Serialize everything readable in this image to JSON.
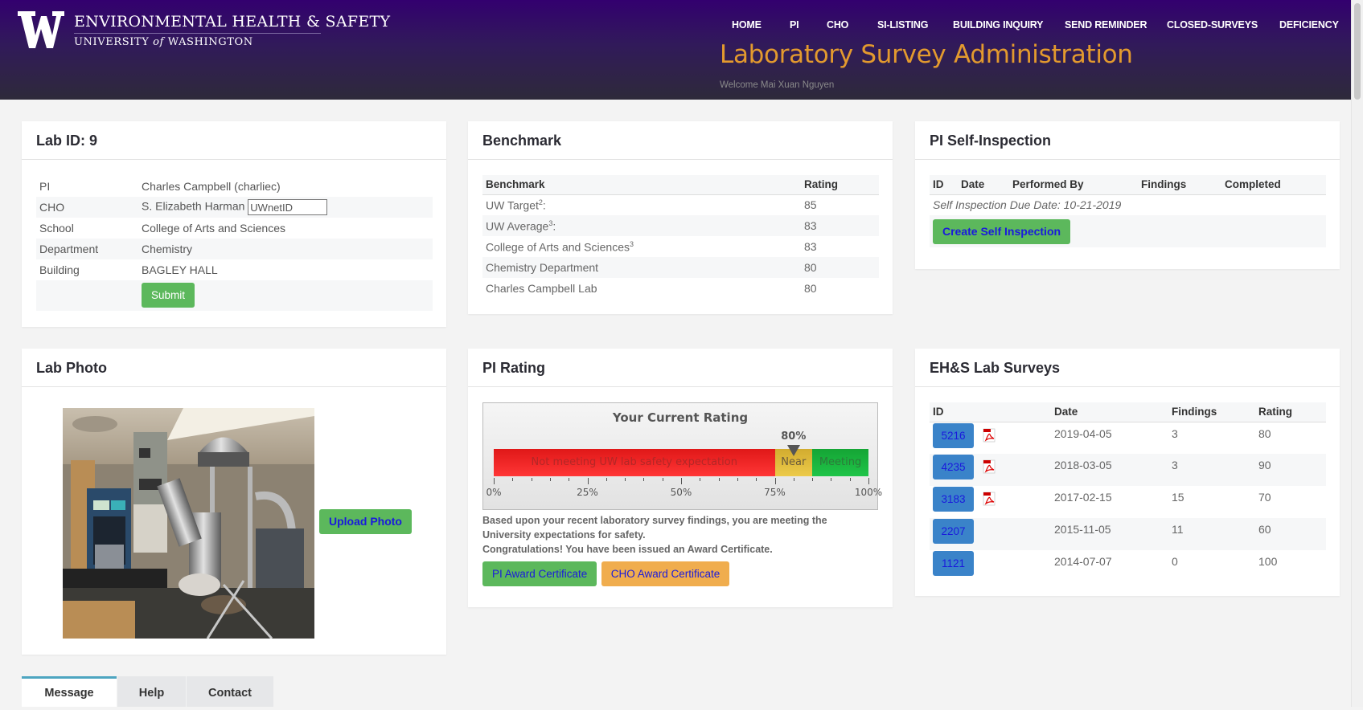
{
  "header": {
    "brand_line1": "ENVIRONMENTAL HEALTH & SAFETY",
    "brand_line2_pre": "UNIVERSITY",
    "brand_line2_of": "of",
    "brand_line2_post": "WASHINGTON",
    "app_title": "Laboratory Survey Administration",
    "welcome": "Welcome Mai Xuan Nguyen",
    "nav": [
      "HOME",
      "PI",
      "CHO",
      "SI-LISTING",
      "BUILDING INQUIRY",
      "SEND REMINDER",
      "CLOSED-SURVEYS",
      "DEFICIENCY"
    ]
  },
  "lab": {
    "title": "Lab ID: 9",
    "rows": [
      {
        "label": "PI",
        "value": "Charles Campbell (charliec)"
      },
      {
        "label": "CHO",
        "value": "S. Elizabeth Harman"
      },
      {
        "label": "School",
        "value": "College of Arts and Sciences"
      },
      {
        "label": "Department",
        "value": "Chemistry"
      },
      {
        "label": "Building",
        "value": "BAGLEY HALL"
      }
    ],
    "uwnetid_value": "UWnetID",
    "submit_label": "Submit"
  },
  "benchmark": {
    "title": "Benchmark",
    "headers": [
      "Benchmark",
      "Rating"
    ],
    "rows": [
      {
        "name": "UW Target",
        "sup": "2",
        "suffix": ":",
        "rating": "85"
      },
      {
        "name": "UW Average",
        "sup": "3",
        "suffix": ":",
        "rating": "83"
      },
      {
        "name": "College of Arts and Sciences",
        "sup": "3",
        "suffix": "",
        "rating": "83"
      },
      {
        "name": "Chemistry Department",
        "sup": "",
        "suffix": "",
        "rating": "80"
      },
      {
        "name": "Charles Campbell Lab",
        "sup": "",
        "suffix": "",
        "rating": "80"
      }
    ]
  },
  "self_inspection": {
    "title": "PI Self-Inspection",
    "headers": [
      "ID",
      "Date",
      "Performed By",
      "Findings",
      "Completed"
    ],
    "due_note": "Self Inspection Due Date: 10-21-2019",
    "create_label": "Create Self Inspection"
  },
  "photo": {
    "title": "Lab Photo",
    "upload_label": "Upload Photo"
  },
  "pi_rating": {
    "title": "PI Rating",
    "gauge_title": "Your Current Rating",
    "value_label": "80%",
    "value": 80,
    "segments": [
      {
        "label": "Not meeting UW lab safety expectation",
        "from": 0,
        "to": 75,
        "color": "#e81c1c"
      },
      {
        "label": "Near",
        "from": 75,
        "to": 85,
        "color": "#ddb93a"
      },
      {
        "label": "Meeting",
        "from": 85,
        "to": 100,
        "color": "#18b23d"
      }
    ],
    "tick_labels": [
      "0%",
      "25%",
      "50%",
      "75%",
      "100%"
    ],
    "message_line1": "Based upon your recent laboratory survey findings, you are meeting the University expectations for safety.",
    "message_line2": "Congratulations! You have been issued an Award Certificate.",
    "pi_award_label": "PI Award Certificate",
    "cho_award_label": "CHO Award Certificate"
  },
  "surveys": {
    "title": "EH&S Lab Surveys",
    "headers": [
      "ID",
      "Date",
      "Findings",
      "Rating"
    ],
    "rows": [
      {
        "id": "5216",
        "pdf": true,
        "date": "2019-04-05",
        "findings": "3",
        "rating": "80"
      },
      {
        "id": "4235",
        "pdf": true,
        "date": "2018-03-05",
        "findings": "3",
        "rating": "90"
      },
      {
        "id": "3183",
        "pdf": true,
        "date": "2017-02-15",
        "findings": "15",
        "rating": "70"
      },
      {
        "id": "2207",
        "pdf": false,
        "date": "2015-11-05",
        "findings": "11",
        "rating": "60"
      },
      {
        "id": "1121",
        "pdf": false,
        "date": "2014-07-07",
        "findings": "0",
        "rating": "100"
      }
    ]
  },
  "tabs": [
    {
      "label": "Message",
      "active": true
    },
    {
      "label": "Help",
      "active": false
    },
    {
      "label": "Contact",
      "active": false
    }
  ],
  "colors": {
    "header_purple": "#33006f",
    "title_gold": "#e39a2e",
    "btn_green": "#5cb85c",
    "btn_blue": "#3a83c9",
    "btn_orange": "#f0ad4e",
    "tab_accent": "#4da5c0"
  }
}
